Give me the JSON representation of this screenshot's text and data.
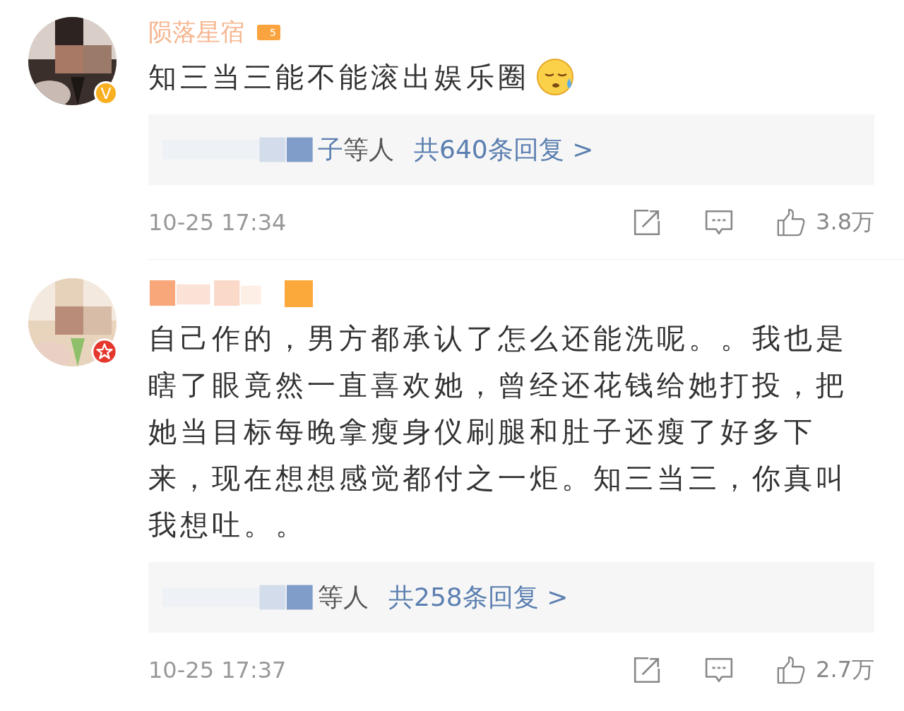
{
  "comments": [
    {
      "username": "陨落星宿",
      "level_badge": "5",
      "badge": {
        "kind": "v",
        "label": "V"
      },
      "text": "知三当三能不能滚出娱乐圈",
      "emoji": true,
      "replies": {
        "names": "子",
        "suffix": "等人",
        "count": "共640条回复 >"
      },
      "time": "10-25 17:34",
      "likes": "3.8万"
    },
    {
      "badge": {
        "kind": "star"
      },
      "text": "自己作的，男方都承认了怎么还能洗呢。。我也是瞎了眼竟然一直喜欢她，曾经还花钱给她打投，把她当目标每晚拿瘦身仪刷腿和肚子还瘦了好多下来，现在想想感觉都付之一炬。知三当三，你真叫我想吐。。",
      "emoji": false,
      "replies": {
        "suffix": "等人",
        "count": "共258条回复 >"
      },
      "time": "10-25 17:37",
      "likes": "2.7万"
    }
  ]
}
